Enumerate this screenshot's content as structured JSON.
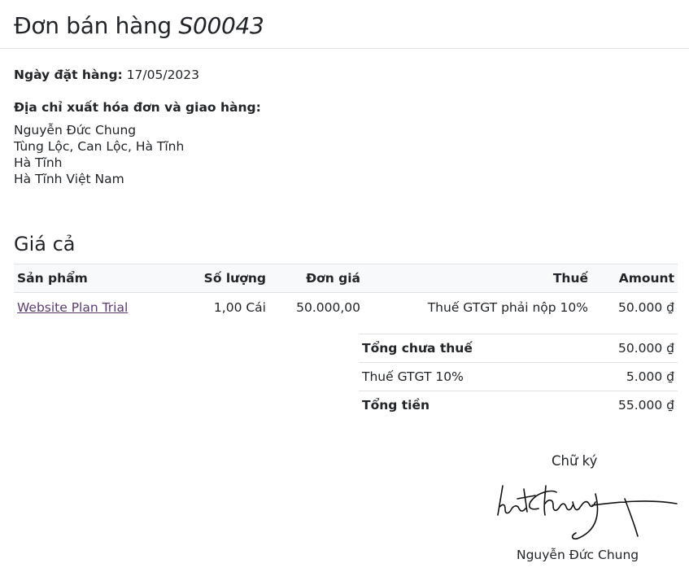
{
  "header": {
    "title_prefix": "Đơn bán hàng",
    "order_number": "S00043"
  },
  "order_info": {
    "date_label": "Ngày đặt hàng:",
    "date_value": "17/05/2023",
    "address_heading": "Địa chỉ xuất hóa đơn và giao hàng:",
    "address_lines": [
      "Nguyễn Đức Chung",
      "Tùng Lộc, Can Lộc, Hà Tĩnh",
      "Hà Tĩnh",
      "Hà Tĩnh Việt Nam"
    ]
  },
  "pricing": {
    "section_title": "Giá cả",
    "columns": [
      "Sản phẩm",
      "Số lượng",
      "Đơn giá",
      "Thuế",
      "Amount"
    ],
    "rows": [
      {
        "product": "Website Plan Trial",
        "quantity": "1,00 Cái",
        "unit_price": "50.000,00",
        "tax": "Thuế GTGT phải nộp 10%",
        "amount": "50.000 ₫"
      }
    ]
  },
  "totals": {
    "subtotal_label": "Tổng chưa thuế",
    "subtotal_value": "50.000 ₫",
    "tax_label": "Thuế GTGT 10%",
    "tax_value": "5.000 ₫",
    "total_label": "Tổng tiền",
    "total_value": "55.000 ₫"
  },
  "signature": {
    "label": "Chữ ký",
    "signer_name": "Nguyễn Đức Chung"
  },
  "colors": {
    "link": "#5c3a72",
    "header_row_background": "#f8f9fa",
    "border": "#dee2e6",
    "text": "#212529"
  }
}
